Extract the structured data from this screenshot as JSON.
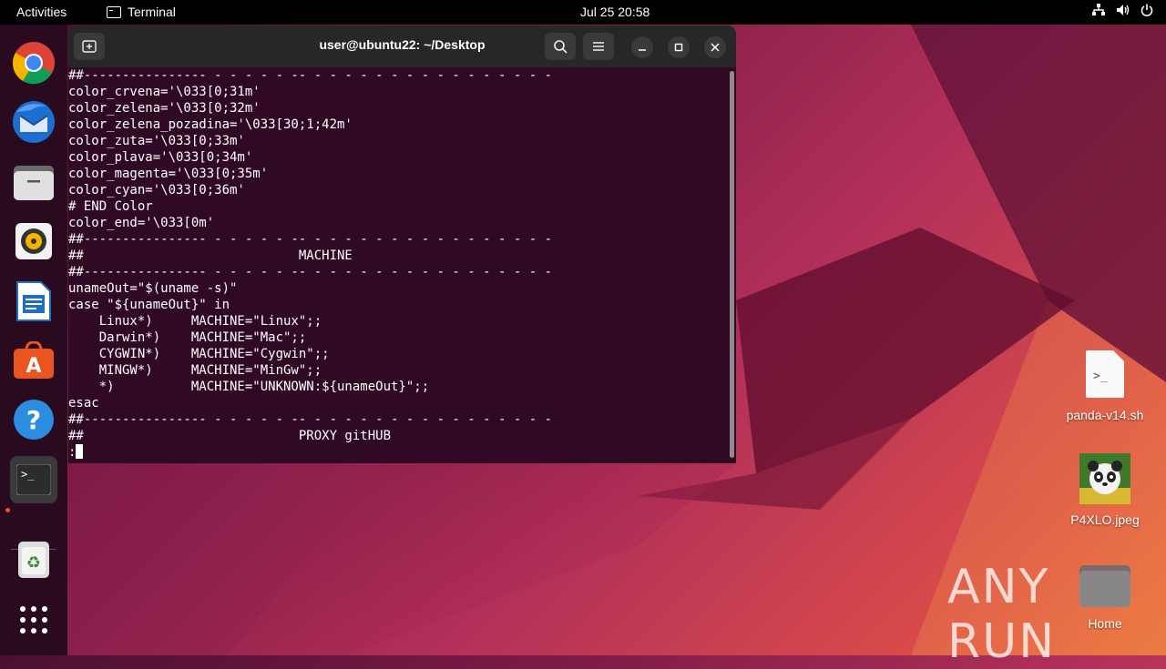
{
  "topbar": {
    "activities": "Activities",
    "app_name": "Terminal",
    "clock": "Jul 25  20:58",
    "tray_icons": [
      "network-icon",
      "volume-icon",
      "power-icon"
    ]
  },
  "dock": {
    "items": [
      {
        "name": "chrome",
        "icon": "chrome-icon"
      },
      {
        "name": "thunderbird",
        "icon": "thunderbird-icon"
      },
      {
        "name": "files",
        "icon": "files-icon"
      },
      {
        "name": "rhythmbox",
        "icon": "rhythmbox-icon"
      },
      {
        "name": "libreoffice-writer",
        "icon": "writer-icon"
      },
      {
        "name": "app-center",
        "icon": "appcenter-icon"
      },
      {
        "name": "help",
        "icon": "help-icon"
      },
      {
        "name": "terminal",
        "icon": "terminal-icon",
        "active": true
      },
      {
        "name": "trash",
        "icon": "trash-icon"
      },
      {
        "name": "show-apps",
        "icon": "grid-icon"
      }
    ]
  },
  "terminal": {
    "title": "user@ubuntu22: ~/Desktop",
    "lines": [
      "##---------------- - - - - - -- - - - - - - - - - - - - - - - -",
      "color_crvena='\\033[0;31m'",
      "color_zelena='\\033[0;32m'",
      "color_zelena_pozadina='\\033[30;1;42m'",
      "color_zuta='\\033[0;33m'",
      "color_plava='\\033[0;34m'",
      "color_magenta='\\033[0;35m'",
      "color_cyan='\\033[0;36m'",
      "# END Color",
      "color_end='\\033[0m'",
      "##---------------- - - - - - -- - - - - - - - - - - - - - - - -",
      "##                            MACHINE",
      "##---------------- - - - - - -- - - - - - - - - - - - - - - - -",
      "unameOut=\"$(uname -s)\"",
      "case \"${unameOut}\" in",
      "    Linux*)     MACHINE=\"Linux\";;",
      "    Darwin*)    MACHINE=\"Mac\";;",
      "    CYGWIN*)    MACHINE=\"Cygwin\";;",
      "    MINGW*)     MACHINE=\"MinGw\";;",
      "    *)          MACHINE=\"UNKNOWN:${unameOut}\";;",
      "esac",
      "##---------------- - - - - - -- - - - - - - - - - - - - - - - -",
      "##                            PROXY gitHUB"
    ],
    "prompt": ":"
  },
  "desktop": {
    "icons": [
      {
        "label": "panda-v14.sh",
        "icon": "script-file-icon"
      },
      {
        "label": "P4XLO.jpeg",
        "icon": "image-file-icon"
      },
      {
        "label": "Home",
        "icon": "home-folder-icon"
      }
    ]
  },
  "watermark": "ANY RUN"
}
